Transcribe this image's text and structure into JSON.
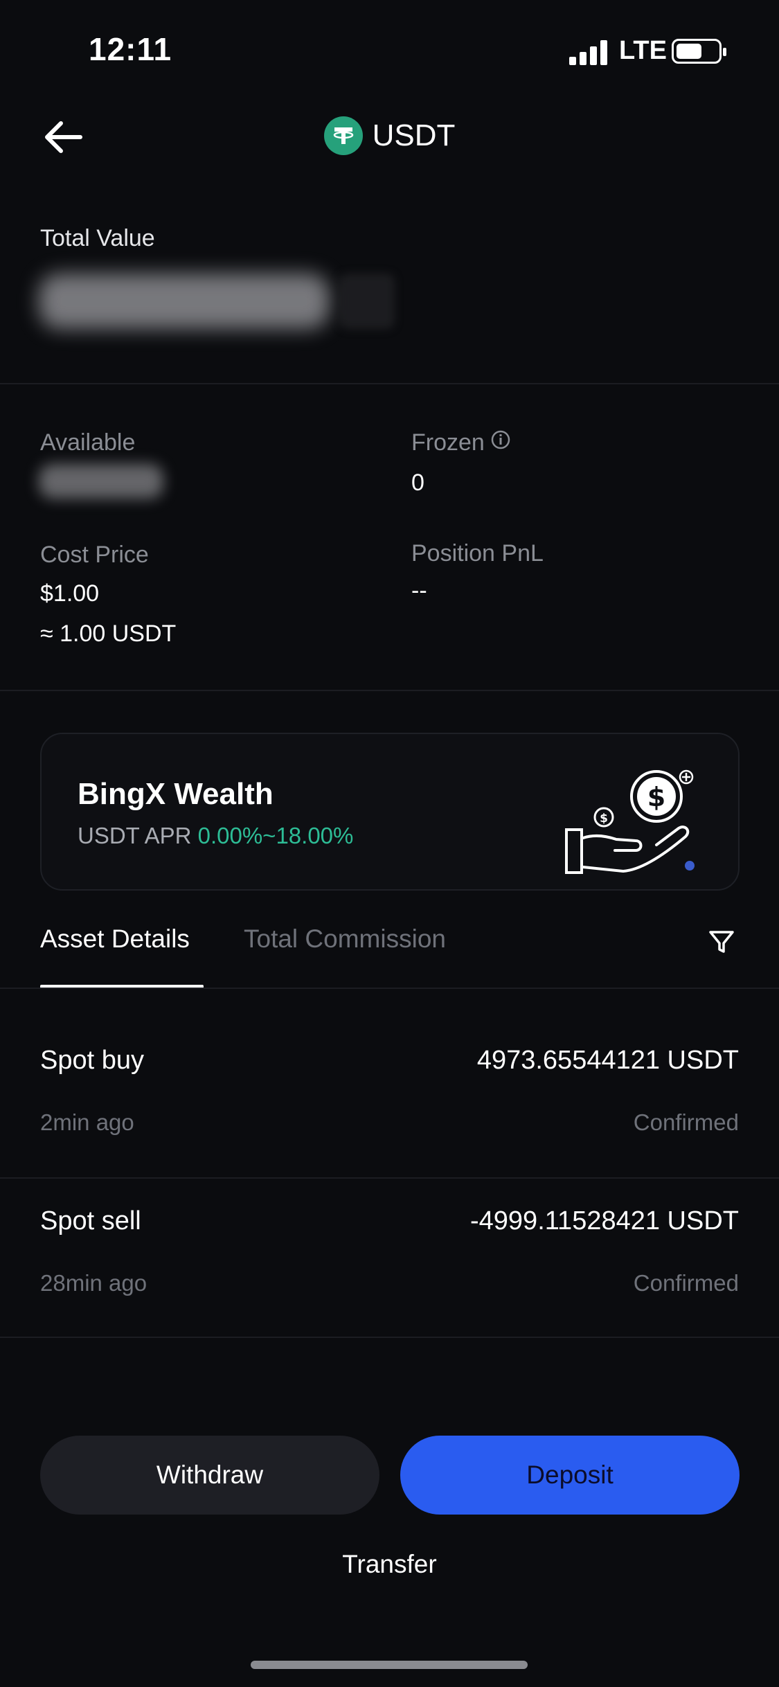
{
  "status_bar": {
    "time": "12:11",
    "network": "LTE"
  },
  "header": {
    "title": "USDT",
    "icon": "usdt-tether-icon"
  },
  "total": {
    "label": "Total Value"
  },
  "stats": {
    "available_label": "Available",
    "frozen_label": "Frozen",
    "frozen_value": "0",
    "cost_price_label": "Cost Price",
    "cost_price_value": "$1.00",
    "cost_price_sub": "≈ 1.00 USDT",
    "position_pnl_label": "Position PnL",
    "position_pnl_value": "--"
  },
  "wealth_card": {
    "title": "BingX Wealth",
    "apr_prefix": "USDT APR ",
    "apr_range": "0.00%~18.00%",
    "accent_color": "#2dbd96"
  },
  "tabs": [
    {
      "label": "Asset Details",
      "active": true
    },
    {
      "label": "Total Commission",
      "active": false
    }
  ],
  "transactions": [
    {
      "type": "Spot buy",
      "amount": "4973.65544121 USDT",
      "time": "2min ago",
      "status": "Confirmed"
    },
    {
      "type": "Spot sell",
      "amount": "-4999.11528421 USDT",
      "time": "28min ago",
      "status": "Confirmed"
    }
  ],
  "actions": {
    "withdraw": "Withdraw",
    "deposit": "Deposit",
    "transfer": "Transfer",
    "deposit_color": "#2a5cf0"
  }
}
